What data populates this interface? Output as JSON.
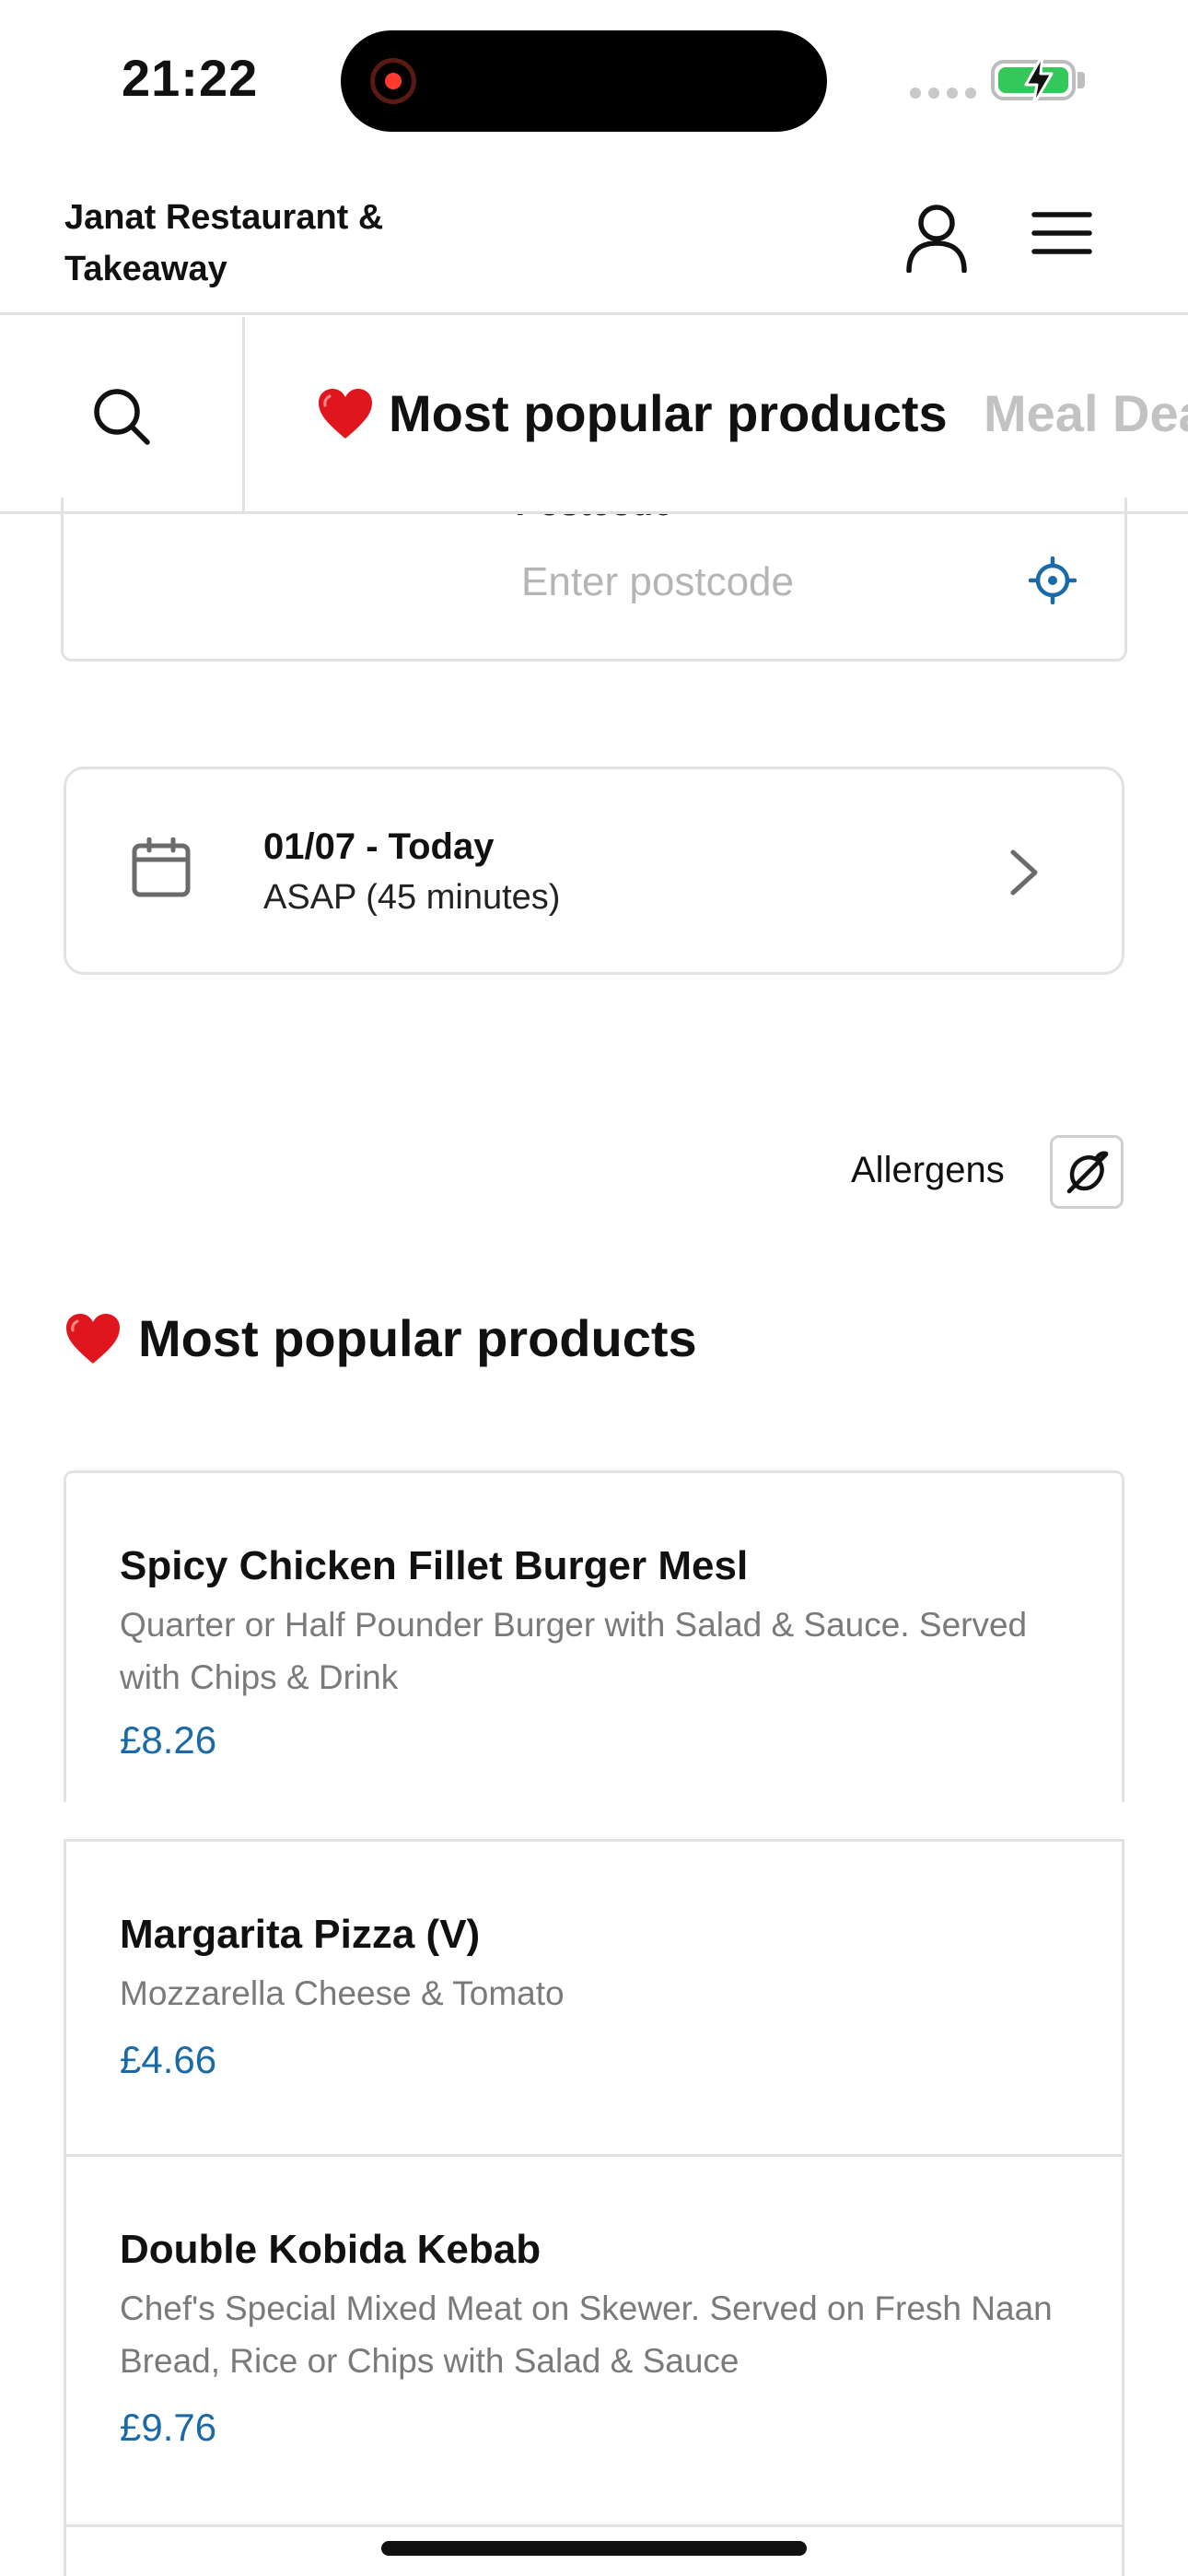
{
  "status_bar": {
    "time": "21:22"
  },
  "header": {
    "restaurant_name": "Janat Restaurant & Takeaway"
  },
  "category_tabs": [
    {
      "label": "Most popular products",
      "icon": "heart-icon",
      "active": true
    },
    {
      "label": "Meal Dea",
      "active": false
    }
  ],
  "postcode": {
    "label": "Postcode",
    "placeholder": "Enter postcode",
    "value": ""
  },
  "delivery_time": {
    "date": "01/07 - Today",
    "eta": "ASAP (45 minutes)"
  },
  "allergens": {
    "label": "Allergens"
  },
  "section": {
    "title": "Most popular products",
    "icon": "heart-icon"
  },
  "products": [
    {
      "name": "Spicy Chicken Fillet Burger Mesl",
      "description": "Quarter or Half Pounder Burger with Salad & Sauce. Served with Chips & Drink",
      "price": "£8.26"
    },
    {
      "name": "Margarita Pizza (V)",
      "description": "Mozzarella Cheese & Tomato",
      "price": "£4.66"
    },
    {
      "name": "Double Kobida Kebab",
      "description": "Chef's Special Mixed Meat on Skewer. Served on Fresh Naan Bread, Rice or Chips with Salad & Sauce",
      "price": "£9.76"
    }
  ],
  "colors": {
    "price": "#1a6aa8",
    "accent": "#1a6aa8",
    "heart": "#e0161e",
    "battery": "#34c759"
  }
}
